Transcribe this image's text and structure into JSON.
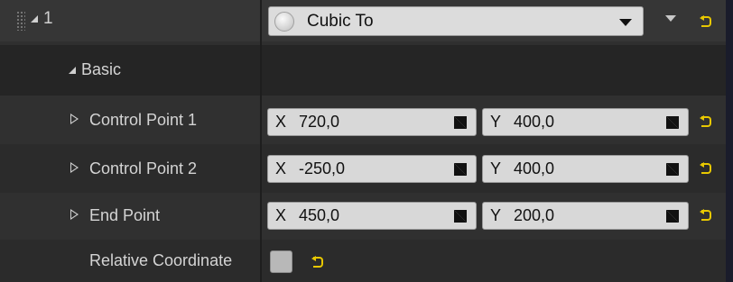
{
  "element": {
    "index": "1"
  },
  "combo": {
    "selected": "Cubic To"
  },
  "basic": {
    "label": "Basic"
  },
  "properties": [
    {
      "label": "Control Point 1",
      "x": "720,0",
      "y": "400,0"
    },
    {
      "label": "Control Point 2",
      "x": "-250,0",
      "y": "400,0"
    },
    {
      "label": "End Point",
      "x": "450,0",
      "y": "200,0"
    }
  ],
  "axes": {
    "x": "X",
    "y": "Y"
  },
  "relative": {
    "label": "Relative Coordinate",
    "checked": false
  },
  "colors": {
    "reset_arrow": "#e8c800",
    "field_bg": "#d8d8d8",
    "panel_bg": "#2f2f2f"
  }
}
